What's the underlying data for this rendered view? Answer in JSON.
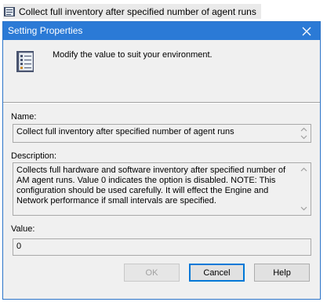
{
  "background_row": {
    "text": "Collect full inventory after specified number of agent runs",
    "icon": "setting-book-icon"
  },
  "dialog": {
    "title": "Setting Properties",
    "close_icon": "close-icon",
    "header_icon": "properties-book-icon",
    "header_text": "Modify the value to suit your environment.",
    "name_label": "Name:",
    "name_value": "Collect full inventory after specified number of agent runs",
    "description_label": "Description:",
    "description_value": "Collects full hardware and software inventory after specified number of AM agent runs. Value 0 indicates the option is disabled. NOTE: This configuration should be used carefully. It will effect the Engine and Network performance if small intervals are specified.",
    "value_label": "Value:",
    "value_value": "0",
    "buttons": {
      "ok": "OK",
      "cancel": "Cancel",
      "help": "Help"
    }
  },
  "colors": {
    "titlebar": "#2b7ad6",
    "dialog_bg": "#f0f0f0",
    "default_button_border": "#0078d7"
  }
}
